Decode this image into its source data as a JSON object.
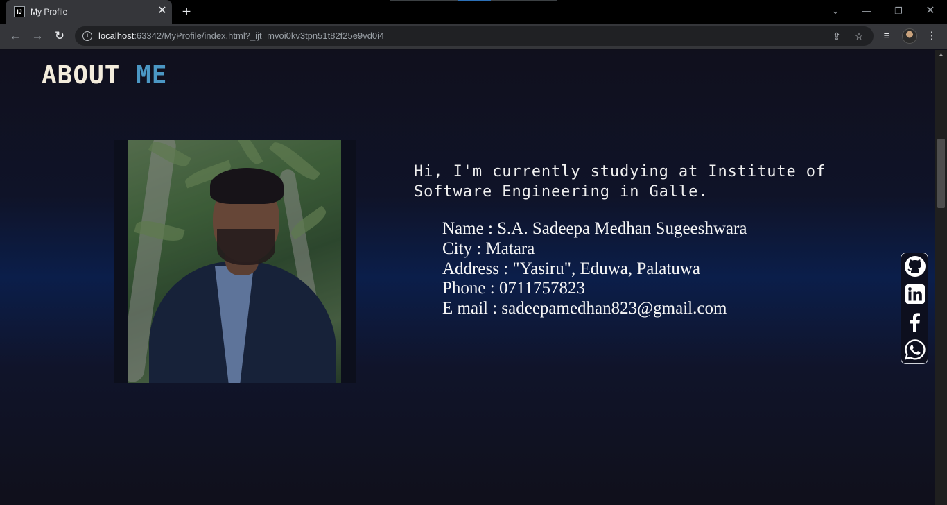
{
  "browser": {
    "tab_title": "My Profile",
    "tab_favicon": "IJ",
    "url_host": "localhost",
    "url_rest": ":63342/MyProfile/index.html?_ijt=mvoi0kv3tpn51t82f25e9vd0i4"
  },
  "page": {
    "section_title_first": "ABOUT",
    "section_title_second": "ME",
    "intro": "Hi, I'm currently studying at Institute of Software Engineering in Galle.",
    "details": [
      "Name : S.A. Sadeepa Medhan Sugeeshwara",
      "City : Matara",
      "Address : \"Yasiru\", Eduwa, Palatuwa",
      "Phone : 0711757823",
      "E mail : sadeepamedhan823@gmail.com"
    ]
  },
  "social": [
    "github-icon",
    "linkedin-icon",
    "facebook-icon",
    "whatsapp-icon"
  ],
  "colors": {
    "title_accent": "#4b97c4",
    "title_primary": "#f3ecdc",
    "page_background": "#10101d"
  }
}
